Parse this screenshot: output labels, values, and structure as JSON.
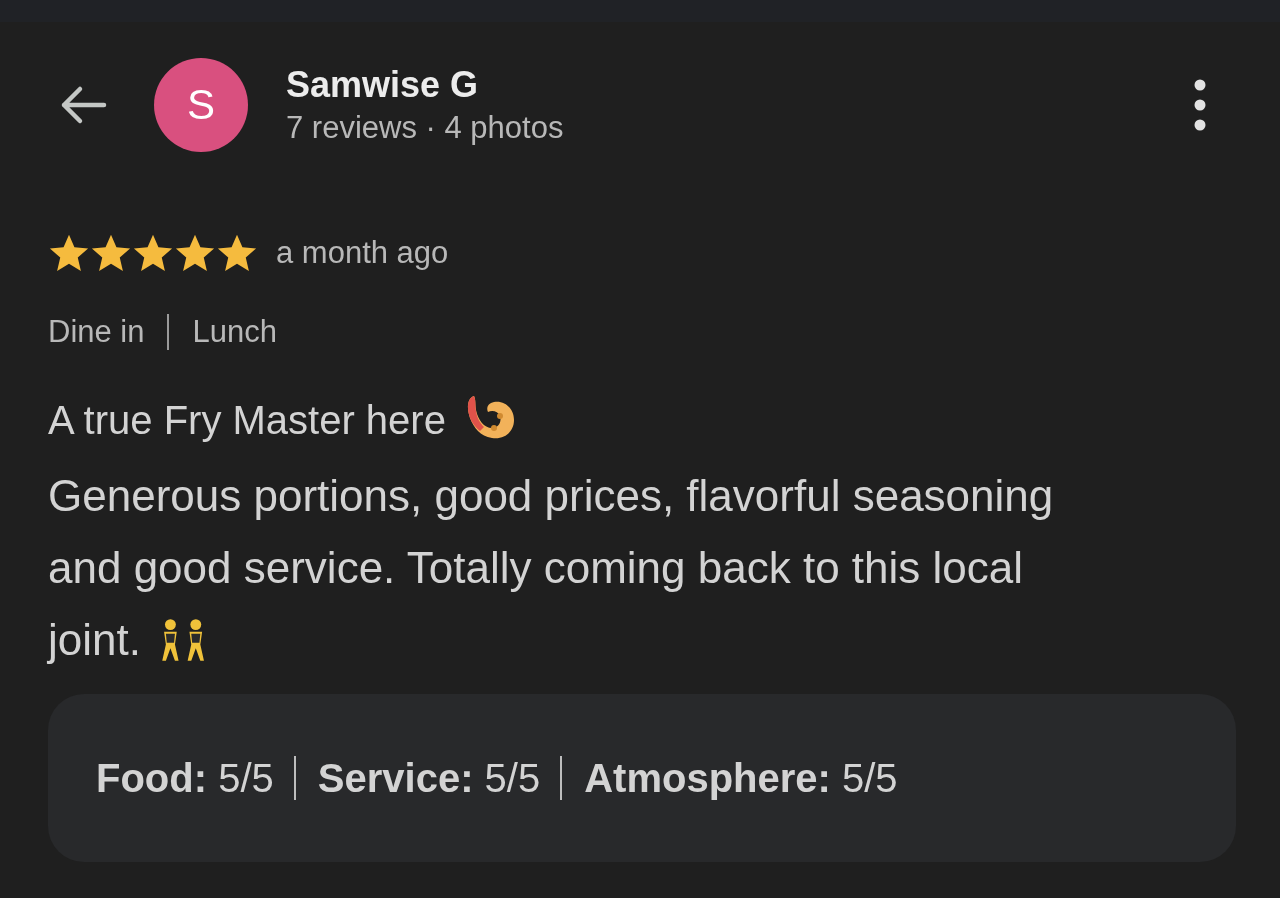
{
  "reviewer": {
    "initial": "S",
    "name": "Samwise G",
    "meta": "7 reviews · 4 photos"
  },
  "review": {
    "stars": 5,
    "time": "a month ago",
    "tags": [
      "Dine in",
      "Lunch"
    ],
    "headline": "A true Fry Master here",
    "body_lines": [
      "Generous portions, good prices, flavorful seasoning",
      "and good service. Totally coming back to this local",
      "joint."
    ],
    "ratings": [
      "**Food:** 5/5",
      "**Service:** 5/5",
      "**Atmosphere:** 5/5"
    ]
  }
}
